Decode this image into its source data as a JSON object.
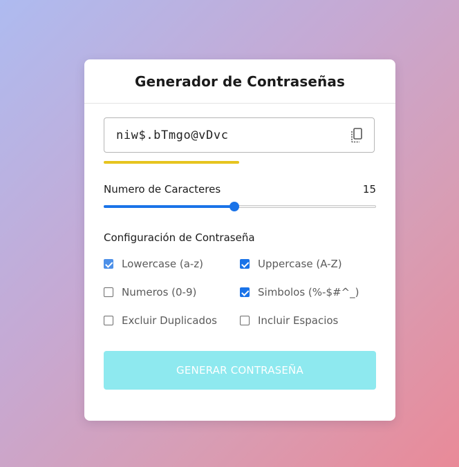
{
  "card": {
    "title": "Generador de Contraseñas"
  },
  "password": {
    "value": "niw$.bTmgo@vDvc",
    "copy_icon": "copy-icon",
    "strength_fraction": 0.5,
    "strength_color": "#e6c41f"
  },
  "length": {
    "label": "Numero de Caracteres",
    "value": "15",
    "slider_fraction": 0.48,
    "accent_color": "#1a73e8"
  },
  "settings": {
    "title": "Configuración de Contraseña",
    "options": [
      {
        "label": "Lowercase (a-z)",
        "checked": true
      },
      {
        "label": "Uppercase (A-Z)",
        "checked": true
      },
      {
        "label": "Numeros (0-9)",
        "checked": false
      },
      {
        "label": "Simbolos (%-$#^_)",
        "checked": true
      },
      {
        "label": "Excluir Duplicados",
        "checked": false
      },
      {
        "label": "Incluir Espacios",
        "checked": false
      }
    ]
  },
  "generate": {
    "label": "GENERAR CONTRASEÑA",
    "color": "#8ee9ef"
  }
}
